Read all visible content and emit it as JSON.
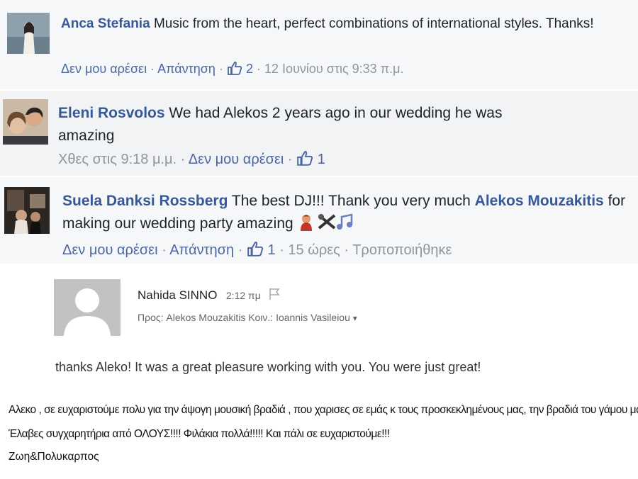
{
  "comments": [
    {
      "author": "Anca Stefania",
      "text": "Music from the heart, perfect combinations of international styles. Thanks!",
      "like_label": "Δεν μου αρέσει",
      "reply_label": "Απάντηση",
      "likes": "2",
      "time": "12 Ιουνίου στις 9:33 π.μ."
    },
    {
      "author": "Eleni Rosvolos",
      "text_line1": "We had Alekos 2 years ago in our wedding he was",
      "text_line2": "amazing",
      "time": "Χθες στις 9:18 μ.μ.",
      "like_label": "Δεν μου αρέσει",
      "likes": "1"
    },
    {
      "author": "Suela Danksi Rossberg",
      "text_pre": "The best DJ!!! Thank you very much",
      "mention_a": "Alekos",
      "mention_b": "Mouzakitis",
      "text_post": "for making our wedding party amazing",
      "like_label": "Δεν μου αρέσει",
      "reply_label": "Απάντηση",
      "likes": "1",
      "time": "15 ώρες",
      "edited": "Τροποποιήθηκε"
    }
  ],
  "email": {
    "sender": "Nahida SINNO",
    "time": "2:12 πμ",
    "to_label": "Προς:",
    "to": "Alekos Mouzakitis",
    "cc_label": "Κοιν.:",
    "cc": "Ioannis Vasileiou",
    "body": "thanks Aleko! It was a great pleasure working with you. You were just great!"
  },
  "note": {
    "line1": "Αλεκο , σε ευχαριστούμε πολυ για την άψογη μουσική βραδιά , που χαρισες σε εμάς κ τους προσκεκλημένους μας, την βραδιά του γάμου μας!!!",
    "line2": "Έλαβες συγχαρητήρια από ΟΛΟΥΣ!!!! Φιλάκια πολλά!!!!! Και πάλι σε ευχαριστούμε!!!",
    "signature": "Ζωη&Πολυκαρπος"
  },
  "colors": {
    "link_blue": "#365899",
    "action_blue": "#4b67a1",
    "meta_gray": "#90949c",
    "text": "#1d2129",
    "comment_bg": "#f6f7f9"
  }
}
